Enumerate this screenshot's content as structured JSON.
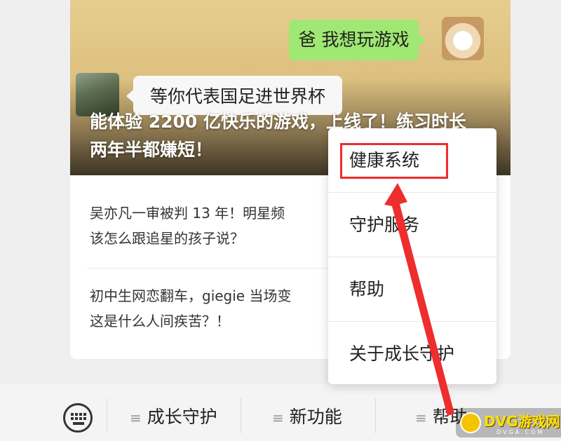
{
  "chat": {
    "child_message": "爸 我想玩游戏",
    "parent_reply": "等你代表国足进世界杯"
  },
  "hero": {
    "headline": "能体验 2200 亿快乐的游戏，上线了！练习时长两年半都嫌短！"
  },
  "articles": [
    {
      "title": "吴亦凡一审被判 13 年！明星频…该怎么跟追星的孩子说？"
    },
    {
      "title": "初中生网恋翻车，giegie 当场变…这是什么人间疾苦？！"
    }
  ],
  "articles_display": [
    {
      "line1": "吴亦凡一审被判 13 年！明星频",
      "line2": "该怎么跟追星的孩子说？"
    },
    {
      "line1": "初中生网恋翻车，giegie 当场变",
      "line2": "这是什么人间疾苦？！"
    }
  ],
  "popup_menu": {
    "items": [
      {
        "label": "健康系统",
        "highlighted": true
      },
      {
        "label": "守护服务"
      },
      {
        "label": "帮助"
      },
      {
        "label": "关于成长守护"
      }
    ]
  },
  "bottom_bar": {
    "keyboard_icon": "keyboard-icon",
    "items": [
      {
        "label": "成长守护"
      },
      {
        "label": "新功能"
      },
      {
        "label": "帮助"
      }
    ]
  },
  "watermark": {
    "brand": "DVG游戏网",
    "sub": "DVGA.COM"
  },
  "colors": {
    "highlight_red": "#ee2d2d",
    "chat_green": "#9ee873",
    "logo_yellow": "#ffe000"
  }
}
